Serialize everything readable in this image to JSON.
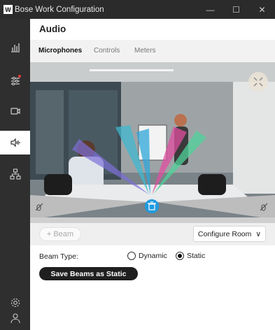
{
  "window": {
    "title": "Bose Work Configuration",
    "logo_letter": "W",
    "minimize_glyph": "—",
    "maximize_glyph": "☐",
    "close_glyph": "✕"
  },
  "sidebar": {
    "items": [
      {
        "icon": "bar-chart-icon",
        "active": false
      },
      {
        "icon": "sliders-icon",
        "active": false,
        "notification_dot": true
      },
      {
        "icon": "video-camera-icon",
        "active": false
      },
      {
        "icon": "speaker-icon",
        "active": true
      },
      {
        "icon": "network-icon",
        "active": false
      }
    ],
    "bottom_items": [
      {
        "icon": "settings-icon"
      },
      {
        "icon": "user-icon"
      }
    ]
  },
  "page": {
    "title": "Audio"
  },
  "tabs": [
    {
      "label": "Microphones",
      "active": true
    },
    {
      "label": "Controls",
      "active": false
    },
    {
      "label": "Meters",
      "active": false
    }
  ],
  "camera": {
    "beam_colors": [
      "#7d6fd8",
      "#3fb8cf",
      "#2fa7d9",
      "#e04fa0",
      "#4fd39a"
    ],
    "accent": "#1e9be0"
  },
  "controls": {
    "beam_button_glyph": "+",
    "beam_button_label": "Beam",
    "configure_room_label": "Configure Room",
    "configure_room_glyph": "∨"
  },
  "beam_type": {
    "label": "Beam Type:",
    "options": [
      {
        "label": "Dynamic",
        "selected": false
      },
      {
        "label": "Static",
        "selected": true
      }
    ],
    "save_button_label": "Save Beams as Static"
  }
}
